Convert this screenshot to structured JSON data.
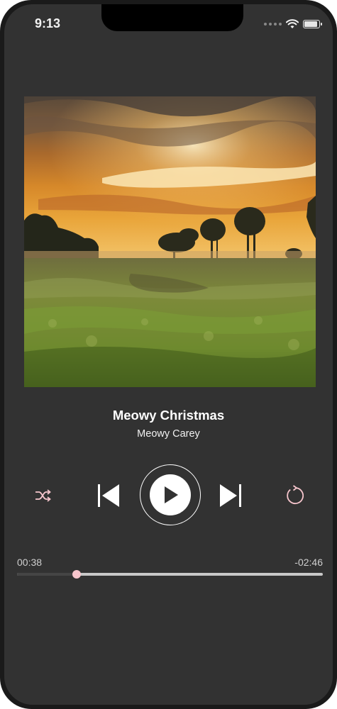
{
  "status_bar": {
    "time": "9:13",
    "signal_icon": "cellular-dots-icon",
    "wifi_icon": "wifi-icon",
    "battery_icon": "battery-icon"
  },
  "now_playing": {
    "album_art": "sunset-field-landscape",
    "title": "Meowy Christmas",
    "artist": "Meowy Carey"
  },
  "controls": {
    "shuffle_icon": "shuffle-icon",
    "previous_icon": "skip-previous-icon",
    "play_icon": "play-icon",
    "next_icon": "skip-next-icon",
    "repeat_icon": "repeat-icon",
    "accent_color": "#f7c6cd"
  },
  "progress": {
    "elapsed": "00:38",
    "remaining": "-02:46",
    "fraction": 0.195
  }
}
